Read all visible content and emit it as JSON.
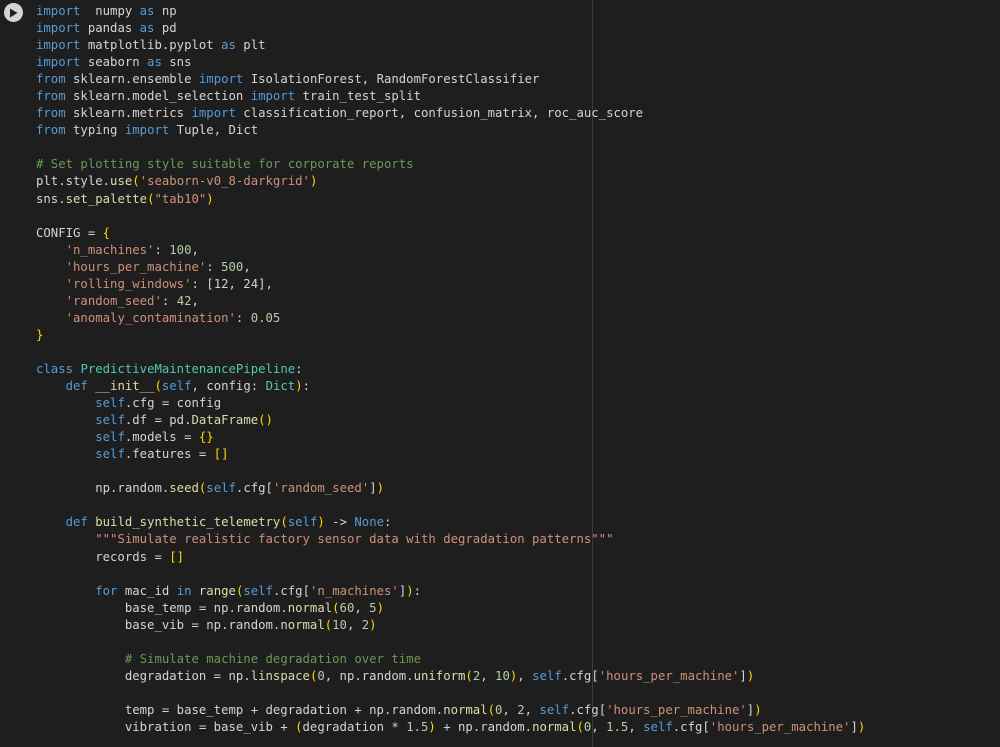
{
  "run_button": {
    "icon": "play-icon"
  },
  "colors": {
    "background": "#1e1e1e",
    "text": "#d4d4d4",
    "keyword": "#569cd6",
    "function": "#dcdcaa",
    "string": "#ce9178",
    "number": "#b5cea8",
    "comment": "#6a9955",
    "type": "#4ec9b0",
    "bracket": "#ffd700"
  },
  "code_lines": [
    [
      [
        "kw",
        "import"
      ],
      [
        "",
        "  numpy "
      ],
      [
        "kw",
        "as"
      ],
      [
        "",
        " np"
      ]
    ],
    [
      [
        "kw",
        "import"
      ],
      [
        "",
        " pandas "
      ],
      [
        "kw",
        "as"
      ],
      [
        "",
        " pd"
      ]
    ],
    [
      [
        "kw",
        "import"
      ],
      [
        "",
        " matplotlib.pyplot "
      ],
      [
        "kw",
        "as"
      ],
      [
        "",
        " plt"
      ]
    ],
    [
      [
        "kw",
        "import"
      ],
      [
        "",
        " seaborn "
      ],
      [
        "kw",
        "as"
      ],
      [
        "",
        " sns"
      ]
    ],
    [
      [
        "kw",
        "from"
      ],
      [
        "",
        " sklearn.ensemble "
      ],
      [
        "kw",
        "import"
      ],
      [
        "",
        " IsolationForest, RandomForestClassifier"
      ]
    ],
    [
      [
        "kw",
        "from"
      ],
      [
        "",
        " sklearn.model_selection "
      ],
      [
        "kw",
        "import"
      ],
      [
        "",
        " train_test_split"
      ]
    ],
    [
      [
        "kw",
        "from"
      ],
      [
        "",
        " sklearn.metrics "
      ],
      [
        "kw",
        "import"
      ],
      [
        "",
        " classification_report, confusion_matrix, roc_auc_score"
      ]
    ],
    [
      [
        "kw",
        "from"
      ],
      [
        "",
        " typing "
      ],
      [
        "kw",
        "import"
      ],
      [
        "",
        " Tuple, Dict"
      ]
    ],
    [],
    [
      [
        "com",
        "# Set plotting style suitable for corporate reports"
      ]
    ],
    [
      [
        "",
        "plt.style."
      ],
      [
        "fn",
        "use"
      ],
      [
        "br",
        "("
      ],
      [
        "str",
        "'seaborn-v0_8-darkgrid'"
      ],
      [
        "br",
        ")"
      ]
    ],
    [
      [
        "",
        "sns."
      ],
      [
        "fn",
        "set_palette"
      ],
      [
        "br",
        "("
      ],
      [
        "str",
        "\"tab10\""
      ],
      [
        "br",
        ")"
      ]
    ],
    [],
    [
      [
        "",
        "CONFIG = "
      ],
      [
        "br",
        "{"
      ]
    ],
    [
      [
        "",
        "    "
      ],
      [
        "str",
        "'n_machines'"
      ],
      [
        "",
        ": "
      ],
      [
        "num",
        "100"
      ],
      [
        "",
        ","
      ]
    ],
    [
      [
        "",
        "    "
      ],
      [
        "str",
        "'hours_per_machine'"
      ],
      [
        "",
        ": "
      ],
      [
        "num",
        "500"
      ],
      [
        "",
        ","
      ]
    ],
    [
      [
        "",
        "    "
      ],
      [
        "str",
        "'rolling_windows'"
      ],
      [
        "",
        ": [12, 24],"
      ]
    ],
    [
      [
        "",
        "    "
      ],
      [
        "str",
        "'random_seed'"
      ],
      [
        "",
        ": "
      ],
      [
        "num",
        "42"
      ],
      [
        "",
        ","
      ]
    ],
    [
      [
        "",
        "    "
      ],
      [
        "str",
        "'anomaly_contamination'"
      ],
      [
        "",
        ": "
      ],
      [
        "num",
        "0.05"
      ]
    ],
    [
      [
        "br",
        "}"
      ]
    ],
    [],
    [
      [
        "kw",
        "class"
      ],
      [
        "",
        " "
      ],
      [
        "ty",
        "PredictiveMaintenancePipeline"
      ],
      [
        "",
        ":"
      ]
    ],
    [
      [
        "",
        "    "
      ],
      [
        "kw",
        "def"
      ],
      [
        "",
        " "
      ],
      [
        "fn",
        "__init__"
      ],
      [
        "br",
        "("
      ],
      [
        "kw",
        "self"
      ],
      [
        "",
        ", config: "
      ],
      [
        "ty",
        "Dict"
      ],
      [
        "br",
        ")"
      ],
      [
        "",
        ":"
      ]
    ],
    [
      [
        "",
        "        "
      ],
      [
        "kw",
        "self"
      ],
      [
        "",
        ".cfg = config"
      ]
    ],
    [
      [
        "",
        "        "
      ],
      [
        "kw",
        "self"
      ],
      [
        "",
        ".df = pd."
      ],
      [
        "fn",
        "DataFrame"
      ],
      [
        "br",
        "()"
      ]
    ],
    [
      [
        "",
        "        "
      ],
      [
        "kw",
        "self"
      ],
      [
        "",
        ".models = "
      ],
      [
        "br",
        "{}"
      ]
    ],
    [
      [
        "",
        "        "
      ],
      [
        "kw",
        "self"
      ],
      [
        "",
        ".features = "
      ],
      [
        "br",
        "[]"
      ]
    ],
    [],
    [
      [
        "",
        "        np.random."
      ],
      [
        "fn",
        "seed"
      ],
      [
        "br",
        "("
      ],
      [
        "kw",
        "self"
      ],
      [
        "",
        ".cfg["
      ],
      [
        "str",
        "'random_seed'"
      ],
      [
        "",
        "]"
      ],
      [
        "br",
        ")"
      ]
    ],
    [],
    [
      [
        "",
        "    "
      ],
      [
        "kw",
        "def"
      ],
      [
        "",
        " "
      ],
      [
        "fn",
        "build_synthetic_telemetry"
      ],
      [
        "br",
        "("
      ],
      [
        "kw",
        "self"
      ],
      [
        "br",
        ")"
      ],
      [
        "",
        " -> "
      ],
      [
        "kw",
        "None"
      ],
      [
        "",
        ":"
      ]
    ],
    [
      [
        "",
        "        "
      ],
      [
        "str",
        "\"\"\"Simulate realistic factory sensor data with degradation patterns\"\"\""
      ]
    ],
    [
      [
        "",
        "        records = "
      ],
      [
        "br",
        "[]"
      ]
    ],
    [],
    [
      [
        "",
        "        "
      ],
      [
        "kw",
        "for"
      ],
      [
        "",
        " mac_id "
      ],
      [
        "kw",
        "in"
      ],
      [
        "",
        " "
      ],
      [
        "fn",
        "range"
      ],
      [
        "br",
        "("
      ],
      [
        "kw",
        "self"
      ],
      [
        "",
        ".cfg["
      ],
      [
        "str",
        "'n_machines'"
      ],
      [
        "",
        "]"
      ],
      [
        "br",
        ")"
      ],
      [
        "",
        ":"
      ]
    ],
    [
      [
        "",
        "            base_temp = np.random."
      ],
      [
        "fn",
        "normal"
      ],
      [
        "br",
        "("
      ],
      [
        "num",
        "60"
      ],
      [
        "",
        ", "
      ],
      [
        "num",
        "5"
      ],
      [
        "br",
        ")"
      ]
    ],
    [
      [
        "",
        "            base_vib = np.random."
      ],
      [
        "fn",
        "normal"
      ],
      [
        "br",
        "("
      ],
      [
        "num",
        "10"
      ],
      [
        "",
        ", "
      ],
      [
        "num",
        "2"
      ],
      [
        "br",
        ")"
      ]
    ],
    [],
    [
      [
        "",
        "            "
      ],
      [
        "com",
        "# Simulate machine degradation over time"
      ]
    ],
    [
      [
        "",
        "            degradation = np."
      ],
      [
        "fn",
        "linspace"
      ],
      [
        "br",
        "("
      ],
      [
        "num",
        "0"
      ],
      [
        "",
        ", np.random."
      ],
      [
        "fn",
        "uniform"
      ],
      [
        "br",
        "("
      ],
      [
        "num",
        "2"
      ],
      [
        "",
        ", "
      ],
      [
        "num",
        "10"
      ],
      [
        "br",
        ")"
      ],
      [
        "",
        ", "
      ],
      [
        "kw",
        "self"
      ],
      [
        "",
        ".cfg["
      ],
      [
        "str",
        "'hours_per_machine'"
      ],
      [
        "",
        "]"
      ],
      [
        "br",
        ")"
      ]
    ],
    [],
    [
      [
        "",
        "            temp = base_temp + degradation + np.random."
      ],
      [
        "fn",
        "normal"
      ],
      [
        "br",
        "("
      ],
      [
        "num",
        "0"
      ],
      [
        "",
        ", "
      ],
      [
        "num",
        "2"
      ],
      [
        "",
        ", "
      ],
      [
        "kw",
        "self"
      ],
      [
        "",
        ".cfg["
      ],
      [
        "str",
        "'hours_per_machine'"
      ],
      [
        "",
        "]"
      ],
      [
        "br",
        ")"
      ]
    ],
    [
      [
        "",
        "            vibration = base_vib + "
      ],
      [
        "br",
        "("
      ],
      [
        "",
        "degradation * "
      ],
      [
        "num",
        "1.5"
      ],
      [
        "br",
        ")"
      ],
      [
        "",
        " + np.random."
      ],
      [
        "fn",
        "normal"
      ],
      [
        "br",
        "("
      ],
      [
        "num",
        "0"
      ],
      [
        "",
        ", "
      ],
      [
        "num",
        "1.5"
      ],
      [
        "",
        ", "
      ],
      [
        "kw",
        "self"
      ],
      [
        "",
        ".cfg["
      ],
      [
        "str",
        "'hours_per_machine'"
      ],
      [
        "",
        "]"
      ],
      [
        "br",
        ")"
      ]
    ]
  ]
}
